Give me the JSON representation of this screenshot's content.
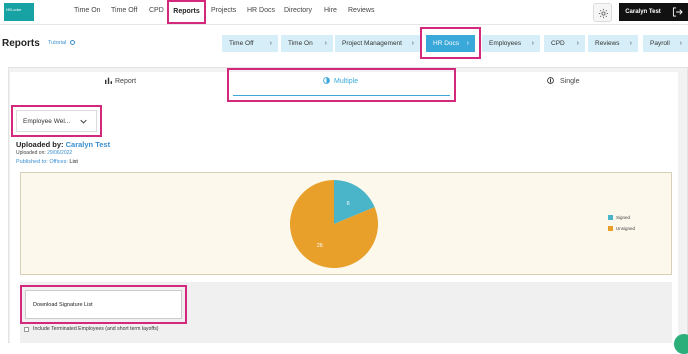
{
  "topnav": {
    "logo_text": "HRLocker",
    "items": [
      "Time On",
      "Time Off",
      "CPD",
      "Reports",
      "Projects",
      "HR Docs",
      "Directory",
      "Hire",
      "Reviews"
    ],
    "user_name": "Caralyn Test"
  },
  "header": {
    "title": "Reports",
    "tutorial": "Tutorial",
    "tabs": [
      "Time Off",
      "Time On",
      "Project Management",
      "HR Docs",
      "Employees",
      "CPD",
      "Reviews",
      "Payroll"
    ],
    "active_tab": "HR Docs"
  },
  "view_toggle": {
    "options": [
      "Report",
      "Multiple",
      "Single"
    ],
    "selected": "Multiple"
  },
  "document_select": {
    "value": "Employee Wel..."
  },
  "doc_info": {
    "uploaded_by_label": "Uploaded by:",
    "uploaded_by_name": "Caralyn Test",
    "uploaded_on_label": "Uploaded on:",
    "uploaded_on_date": "29/06/2022",
    "published_label": "Published to: Offices:",
    "published_value": "List"
  },
  "chart_data": {
    "type": "pie",
    "labels": [
      "Signed",
      "Unsigned"
    ],
    "values": [
      6,
      26
    ],
    "colors": [
      "#4ab5c9",
      "#e8a02a"
    ],
    "legend_position": "right"
  },
  "actions": {
    "download_label": "Download Signature List",
    "include_terminated_label": "Include Terminated Employees (and short term layoffs)"
  },
  "colors": {
    "accent": "#3aa8d9",
    "highlight": "#d4287d",
    "brand": "#17a2a4"
  }
}
